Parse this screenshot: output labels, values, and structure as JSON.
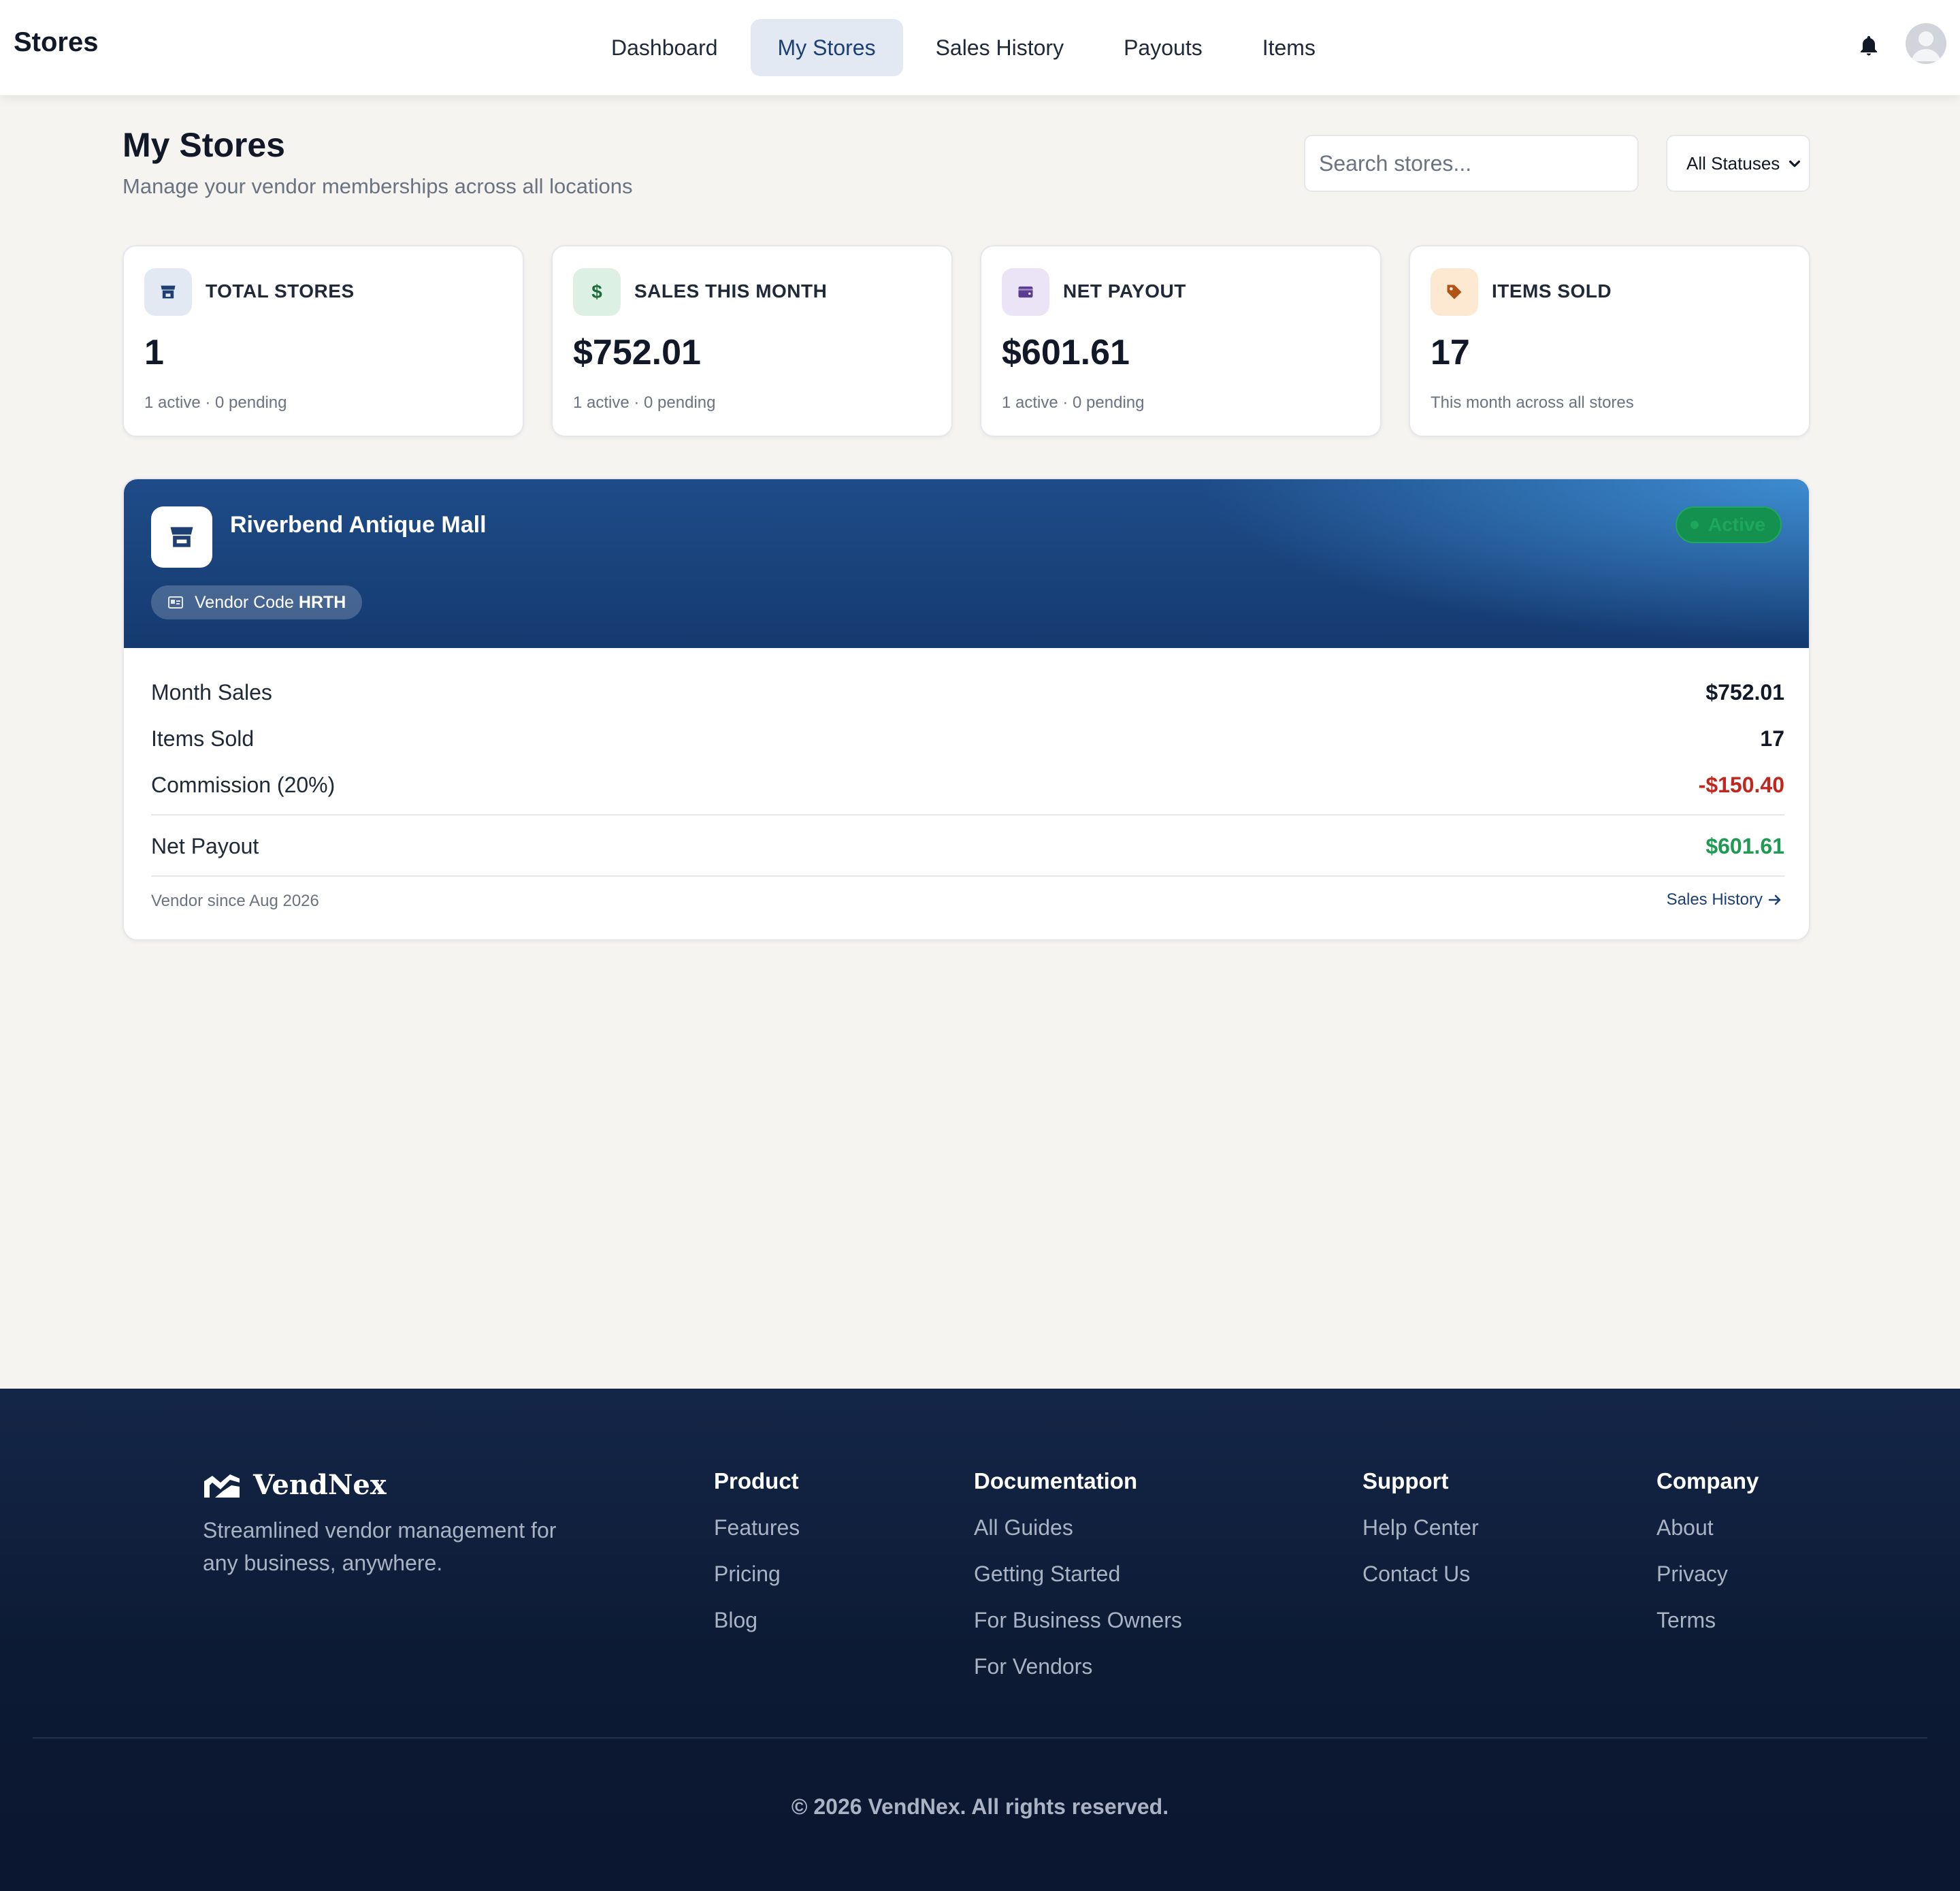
{
  "nav": {
    "brand": "Stores",
    "links": [
      "Dashboard",
      "My Stores",
      "Sales History",
      "Payouts",
      "Items"
    ],
    "active": "My Stores"
  },
  "header": {
    "title": "My Stores",
    "subtitle": "Manage your vendor memberships across all locations",
    "search_placeholder": "Search stores...",
    "status_filter": "All Statuses"
  },
  "stats": [
    {
      "label": "TOTAL STORES",
      "value": "1",
      "note": "1 active · 0 pending",
      "icon": "store-icon",
      "icon_bg": "#e3e9f2",
      "icon_color": "#1e3f73"
    },
    {
      "label": "SALES THIS MONTH",
      "value": "$752.01",
      "note": "1 active · 0 pending",
      "icon": "dollar-icon",
      "icon_bg": "#dcf1e4",
      "icon_color": "#1e6b3c"
    },
    {
      "label": "NET PAYOUT",
      "value": "$601.61",
      "note": "1 active · 0 pending",
      "icon": "wallet-icon",
      "icon_bg": "#ebe4f6",
      "icon_color": "#5b3c92"
    },
    {
      "label": "ITEMS SOLD",
      "value": "17",
      "note": "This month across all stores",
      "icon": "tag-icon",
      "icon_bg": "#fde8d2",
      "icon_color": "#b05418"
    }
  ],
  "store": {
    "name": "Riverbend Antique Mall",
    "vendor_code_label": "Vendor Code",
    "vendor_code": "HRTH",
    "status": "Active",
    "rows": {
      "month_sales_label": "Month Sales",
      "month_sales": "$752.01",
      "items_sold_label": "Items Sold",
      "items_sold": "17",
      "commission_label": "Commission (20%)",
      "commission": "-$150.40",
      "net_payout_label": "Net Payout",
      "net_payout": "$601.61"
    },
    "since": "Vendor since Aug 2026",
    "history_link": "Sales History"
  },
  "footer": {
    "brand": "VendNex",
    "tagline": "Streamlined vendor management for any business, anywhere.",
    "columns": [
      {
        "title": "Product",
        "links": [
          "Features",
          "Pricing",
          "Blog"
        ]
      },
      {
        "title": "Documentation",
        "links": [
          "All Guides",
          "Getting Started",
          "For Business Owners",
          "For Vendors"
        ]
      },
      {
        "title": "Support",
        "links": [
          "Help Center",
          "Contact Us"
        ]
      },
      {
        "title": "Company",
        "links": [
          "About",
          "Privacy",
          "Terms"
        ]
      }
    ],
    "copyright": "© 2026 VendNex. All rights reserved."
  },
  "colors": {
    "accent": "#1e3f73",
    "negative": "#c0281f",
    "positive": "#1e9a53",
    "footer_bg": "#0c1a33"
  }
}
